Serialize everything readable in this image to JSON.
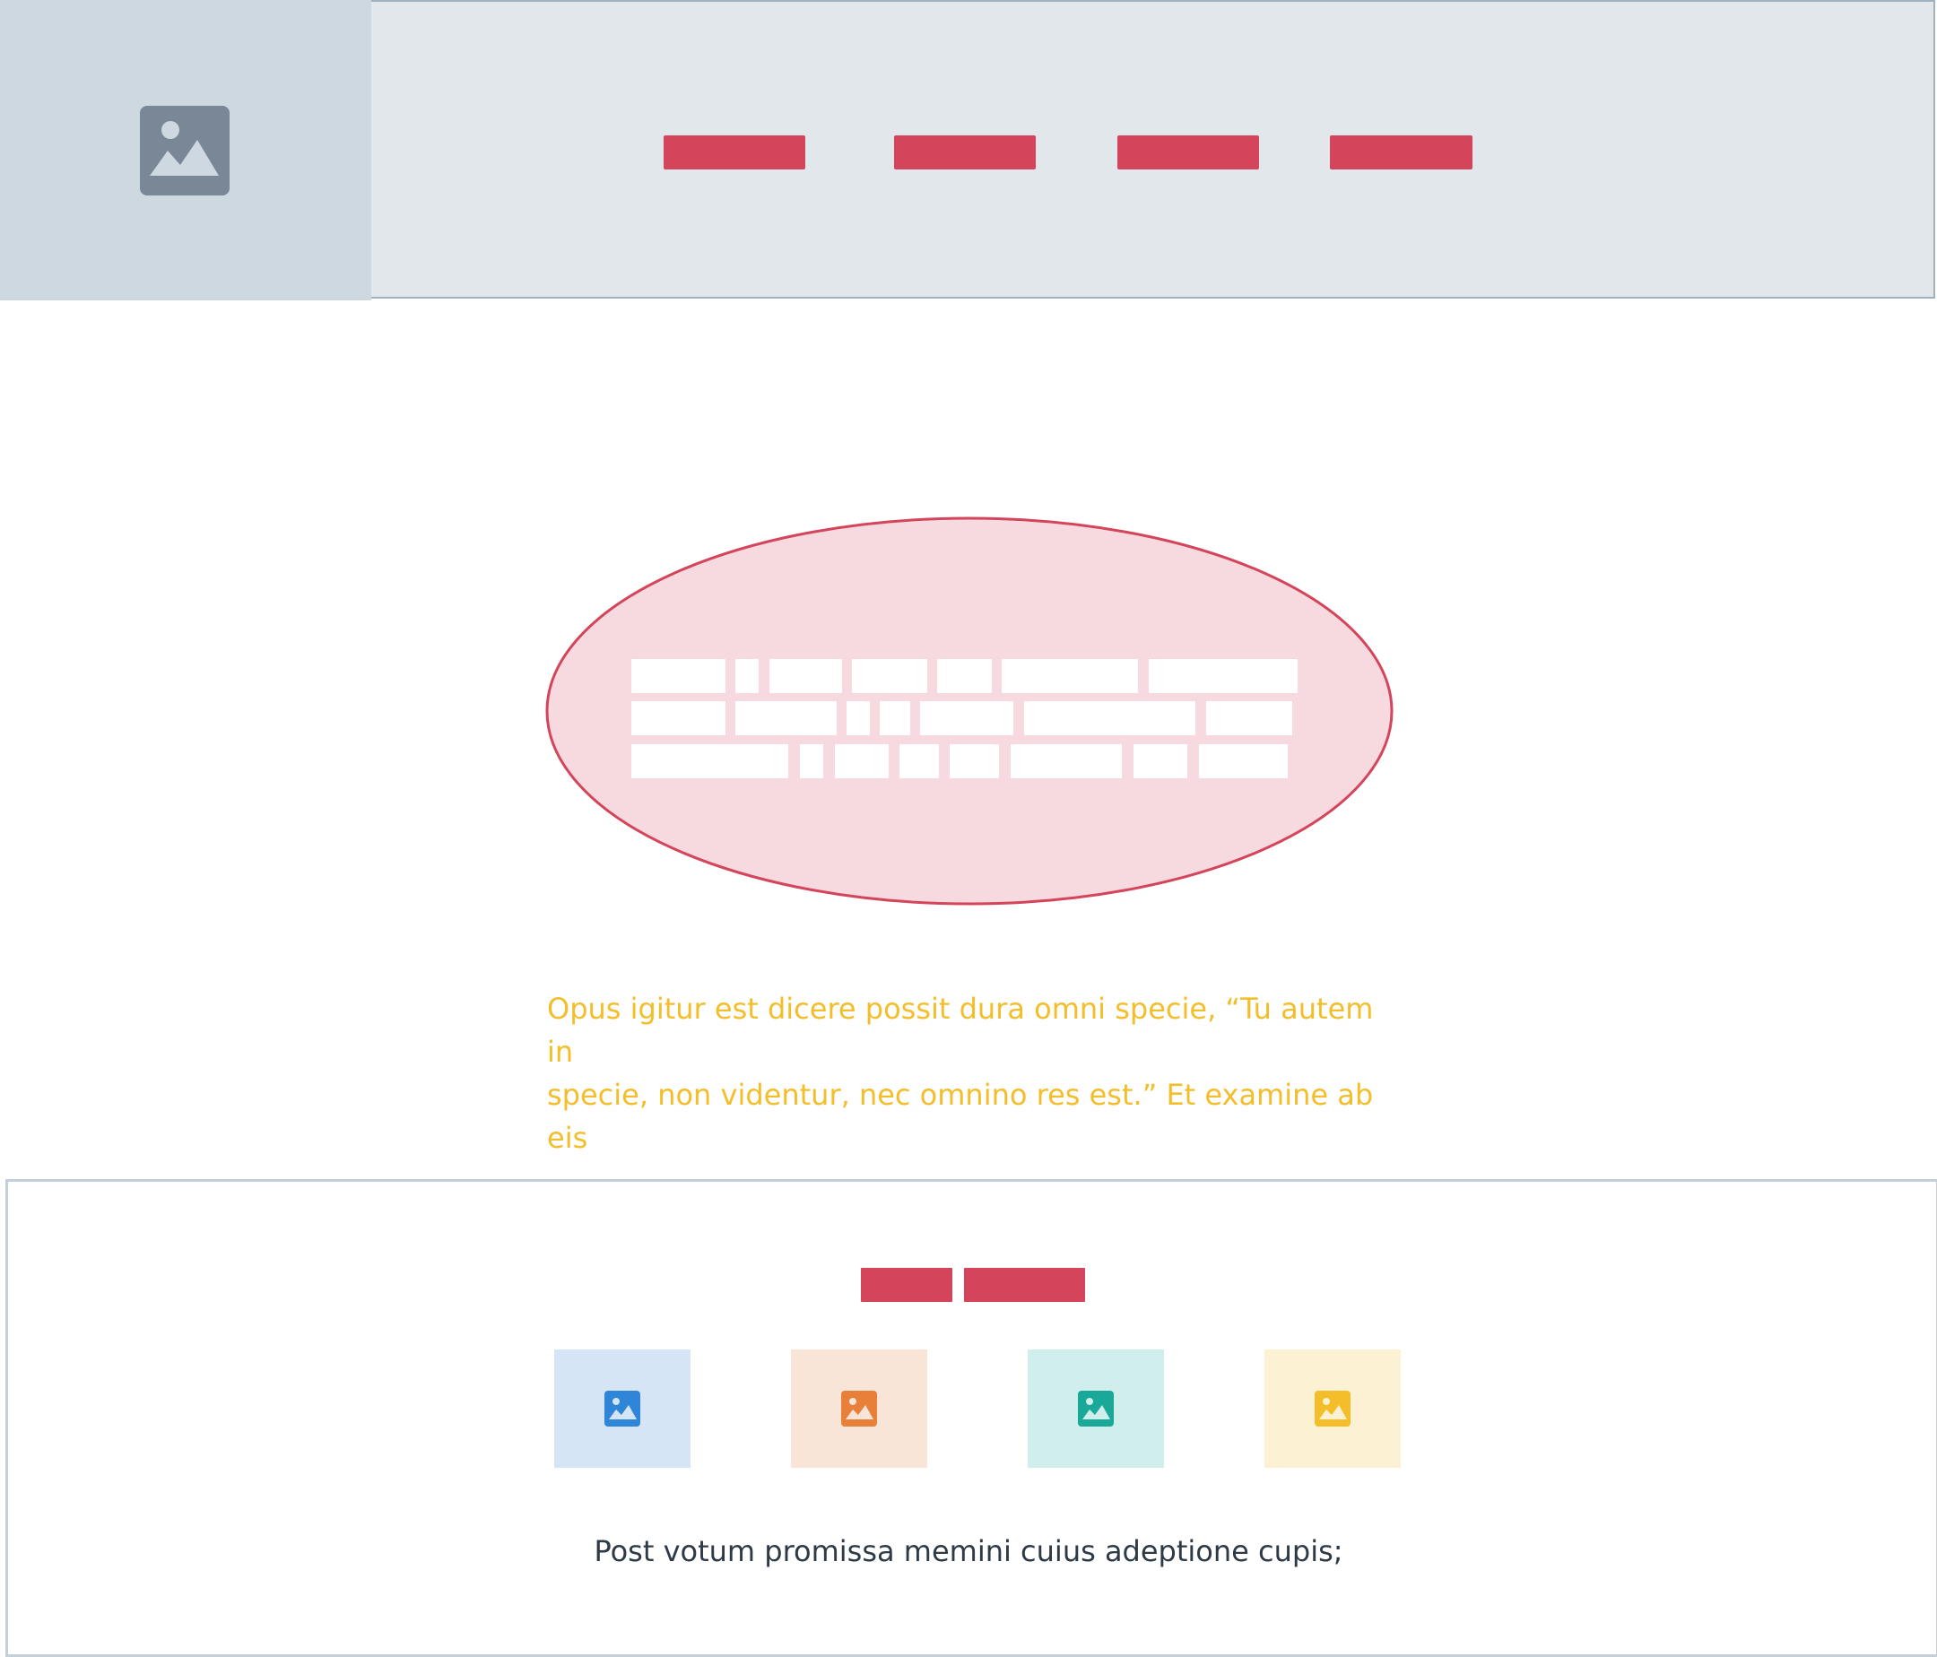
{
  "header": {
    "logo_icon": "image-placeholder-icon",
    "nav_items": [
      "",
      "",
      "",
      ""
    ]
  },
  "hero": {
    "headline_redacted": true,
    "caption": "Opus igitur est dicere possit dura omni specie, “Tu autem in\nspecie, non videntur, nec omnino res est.” Et examine ab eis"
  },
  "feature": {
    "tags": [
      "",
      ""
    ],
    "tiles": [
      {
        "icon": "image-icon",
        "accent": "#2f86d8",
        "bg": "#d5e5f5"
      },
      {
        "icon": "image-icon",
        "accent": "#e8803a",
        "bg": "#f9e4d8"
      },
      {
        "icon": "image-icon",
        "accent": "#1aa899",
        "bg": "#d0eeeb"
      },
      {
        "icon": "image-icon",
        "accent": "#f4bd2a",
        "bg": "#fdf1d3"
      }
    ],
    "text": "Post votum promissa memini cuius adeptione cupis;"
  },
  "colors": {
    "accent": "#d4455c",
    "caption": "#f4bd2a",
    "header_bg": "#e2e7ec",
    "logo_bg": "#ced8e0"
  }
}
